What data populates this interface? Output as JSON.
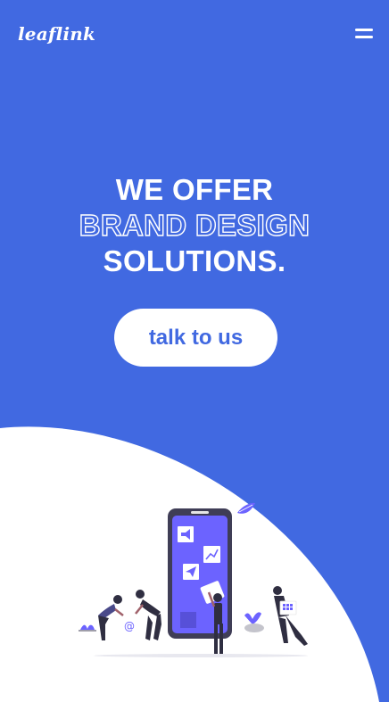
{
  "brand": {
    "logo_text": "leaflink",
    "accent_color": "#4169e1"
  },
  "nav": {
    "menu_icon": "hamburger-menu-icon"
  },
  "hero": {
    "line1": "WE OFFER",
    "line2": "BRAND DESIGN",
    "line3": "SOLUTIONS.",
    "cta_label": "talk to us"
  },
  "illustration": {
    "icons": [
      "megaphone-icon",
      "chart-icon",
      "send-icon",
      "at-sign-icon",
      "leaf-icon"
    ]
  }
}
